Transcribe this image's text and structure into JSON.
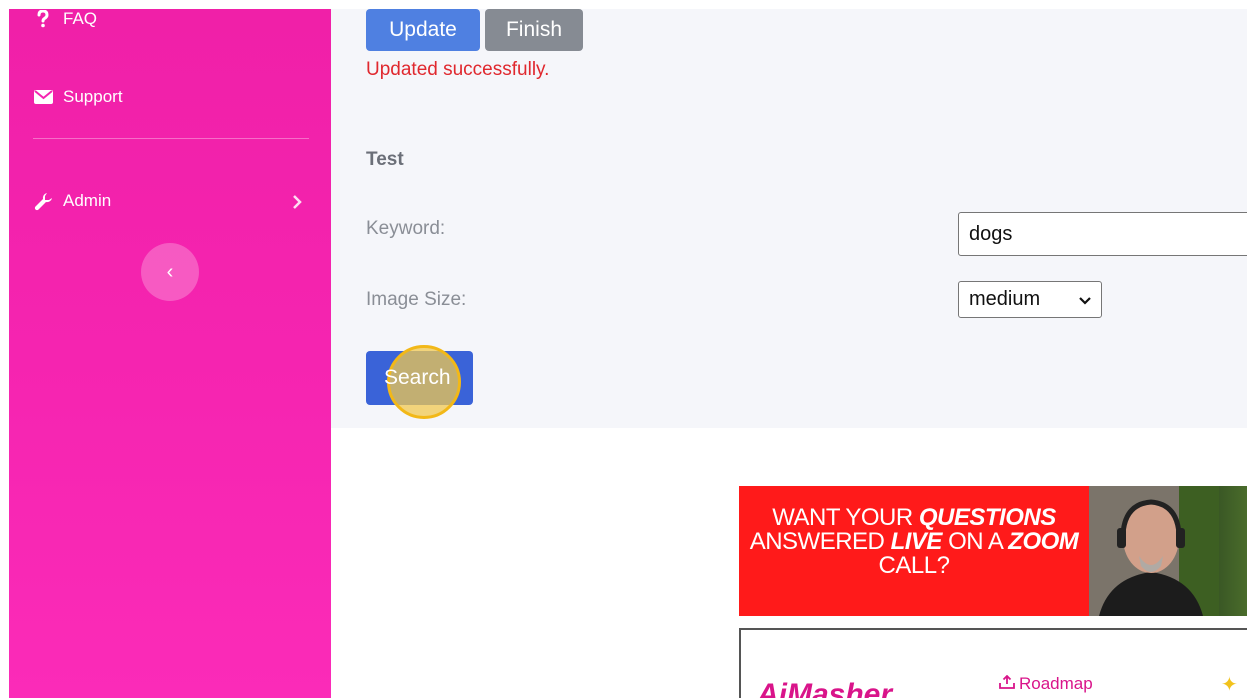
{
  "sidebar": {
    "items": [
      {
        "label": "FAQ",
        "icon": "question-icon"
      },
      {
        "label": "Support",
        "icon": "envelope-icon"
      },
      {
        "label": "Admin",
        "icon": "wrench-icon"
      }
    ],
    "collapse_icon": "‹",
    "bg_color": "#f524b0"
  },
  "form": {
    "update_label": "Update",
    "finish_label": "Finish",
    "success_message": "Updated successfully.",
    "section_title": "Test",
    "keyword_label": "Keyword:",
    "keyword_value": "dogs",
    "image_size_label": "Image Size:",
    "image_size_value": "medium",
    "search_label": "Search"
  },
  "banner": {
    "line1a": "WANT YOUR ",
    "line1b": "QUESTIONS",
    "line2a": "ANSWERED ",
    "line2b": "LIVE",
    "line2c": " ON A ",
    "line2d": "ZOOM",
    "line3": "CALL?"
  },
  "promo": {
    "logo": "AiMasher",
    "roadmap_label": "Roadmap"
  },
  "colors": {
    "accent_blue": "#4f80e1",
    "error_red": "#e0282e",
    "brand_pink": "#d9148a"
  }
}
